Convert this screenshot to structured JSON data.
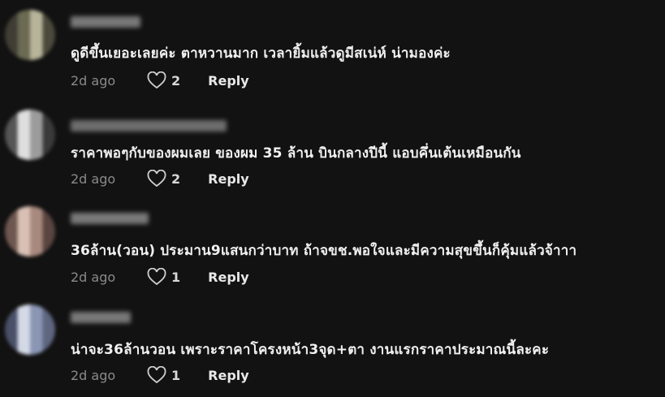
{
  "comments": [
    {
      "text": "ดูดีขึ้นเยอะเลยค่ะ ตาหวานมาก เวลายิ้มแล้วดูมีสเน่ห์ น่ามองค่ะ",
      "time": "2d ago",
      "likes": "2",
      "reply_label": "Reply",
      "avatar_colors": [
        "#6b6a52",
        "#b8b49a",
        "#3f3d34"
      ]
    },
    {
      "text": "ราคาพอๆกับของผมเลย ของผม 35 ล้าน บินกลางปีนี้ แอบคึ่นเต้นเหมือนกัน",
      "time": "2d ago",
      "likes": "2",
      "reply_label": "Reply",
      "avatar_colors": [
        "#9c9c9c",
        "#dedede",
        "#555555"
      ]
    },
    {
      "text": "36ล้าน(วอน) ประมาน9แสนกว่าบาท ถ้าจขช.พอใจและมีความสุขขึ้นก็คุ้มแล้วจ้าาา",
      "time": "2d ago",
      "likes": "1",
      "reply_label": "Reply",
      "avatar_colors": [
        "#a8897e",
        "#d9c0b4",
        "#6e5750"
      ]
    },
    {
      "text": "น่าจะ36ล้านวอน เพราะราคาโครงหน้า3จุด+ตา งานแรกราคาประมาณนี้ละคะ",
      "time": "2d ago",
      "likes": "1",
      "reply_label": "Reply",
      "avatar_colors": [
        "#8a96b4",
        "#d4d9e6",
        "#4a5068"
      ]
    }
  ]
}
